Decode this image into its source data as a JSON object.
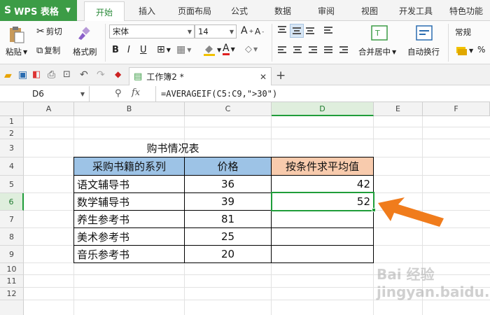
{
  "app": {
    "logo": "S",
    "name": "WPS 表格"
  },
  "tabs": [
    "开始",
    "插入",
    "页面布局",
    "公式",
    "数据",
    "审阅",
    "视图",
    "开发工具",
    "特色功能"
  ],
  "active_tab": "开始",
  "ribbon": {
    "paste": "粘贴",
    "cut": "剪切",
    "copy": "复制",
    "format_painter": "格式刷",
    "font_name": "宋体",
    "font_size": "14",
    "merge_center": "合并居中",
    "wrap_text": "自动换行",
    "number_format": "常规"
  },
  "document_tab": {
    "title": "工作簿2 *"
  },
  "formula_bar": {
    "name_box": "D6",
    "fx": "fx",
    "formula": "=AVERAGEIF(C5:C9,\">30\")"
  },
  "columns": [
    "A",
    "B",
    "C",
    "D",
    "E",
    "F"
  ],
  "rows": [
    "1",
    "2",
    "3",
    "4",
    "5",
    "6",
    "7",
    "8",
    "9",
    "10",
    "11",
    "12"
  ],
  "sheet": {
    "title": "购书情况表",
    "headers": {
      "b": "采购书籍的系列",
      "c": "价格",
      "d": "按条件求平均值"
    },
    "records": [
      {
        "series": "语文辅导书",
        "price": "36",
        "avg": "42"
      },
      {
        "series": "数学辅导书",
        "price": "39",
        "avg": "52"
      },
      {
        "series": "养生参考书",
        "price": "81",
        "avg": ""
      },
      {
        "series": "美术参考书",
        "price": "25",
        "avg": ""
      },
      {
        "series": "音乐参考书",
        "price": "20",
        "avg": ""
      }
    ]
  },
  "colors": {
    "brand": "#3c9c46",
    "header_blue": "#9dc3e6",
    "header_orange": "#f8cbad",
    "select_green": "#1f9d3a",
    "arrow": "#f07c1c"
  },
  "watermark": "Bai 经验 jingyan.baidu.com"
}
